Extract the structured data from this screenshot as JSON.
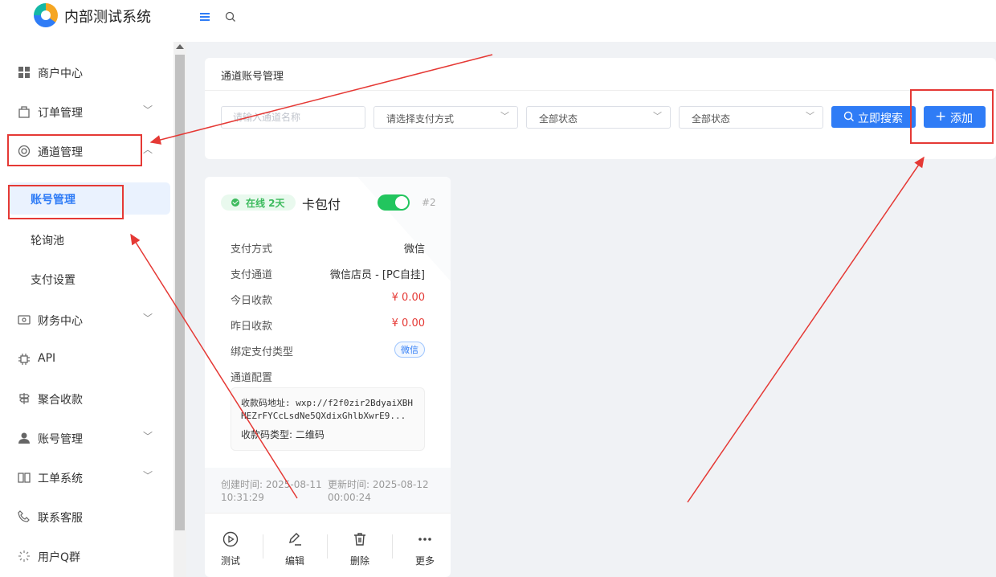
{
  "app": {
    "title": "内部测试系统"
  },
  "sidebar": {
    "items": [
      {
        "label": "商户中心"
      },
      {
        "label": "订单管理"
      },
      {
        "label": "通道管理"
      },
      {
        "label": "财务中心"
      },
      {
        "label": "API"
      },
      {
        "label": "聚合收款"
      },
      {
        "label": "账号管理"
      },
      {
        "label": "工单系统"
      },
      {
        "label": "联系客服"
      },
      {
        "label": "用户Q群"
      }
    ],
    "sub_items": [
      {
        "label": "账号管理"
      },
      {
        "label": "轮询池"
      },
      {
        "label": "支付设置"
      }
    ]
  },
  "panel": {
    "title": "通道账号管理",
    "name_placeholder": "请输入通道名称",
    "pay_method_select": "请选择支付方式",
    "status_select_1": "全部状态",
    "status_select_2": "全部状态",
    "search_button": "立即搜索",
    "add_button": "添加"
  },
  "card": {
    "status_badge": "在线 2天",
    "name": "卡包付",
    "id": "#2",
    "fields": [
      {
        "key": "支付方式",
        "value": "微信"
      },
      {
        "key": "支付通道",
        "value": "微信店员 - [PC自挂]"
      },
      {
        "key": "今日收款",
        "value": "¥ 0.00"
      },
      {
        "key": "昨日收款",
        "value": "¥ 0.00"
      },
      {
        "key": "绑定支付类型",
        "value": "微信"
      },
      {
        "key": "通道配置",
        "value": ""
      }
    ],
    "config_line1": "收款码地址: wxp://f2f0zir2BdyaiXBHHEZrFYCcLsdNe5QXdixGhlbXwrE9...",
    "config_line2": "收款码类型: 二维码",
    "created": "创建时间: 2025-08-11 10:31:29",
    "created_a": "创建时间: 2025-08-11",
    "created_b": "10:31:29",
    "updated_a": "更新时间: 2025-08-12",
    "updated_b": "00:00:24",
    "actions": [
      {
        "label": "测试"
      },
      {
        "label": "编辑"
      },
      {
        "label": "删除"
      },
      {
        "label": "更多"
      }
    ]
  },
  "colors": {
    "primary": "#2f7cf6",
    "success": "#22c55e",
    "danger": "#e53935",
    "annotation": "#e53935"
  }
}
